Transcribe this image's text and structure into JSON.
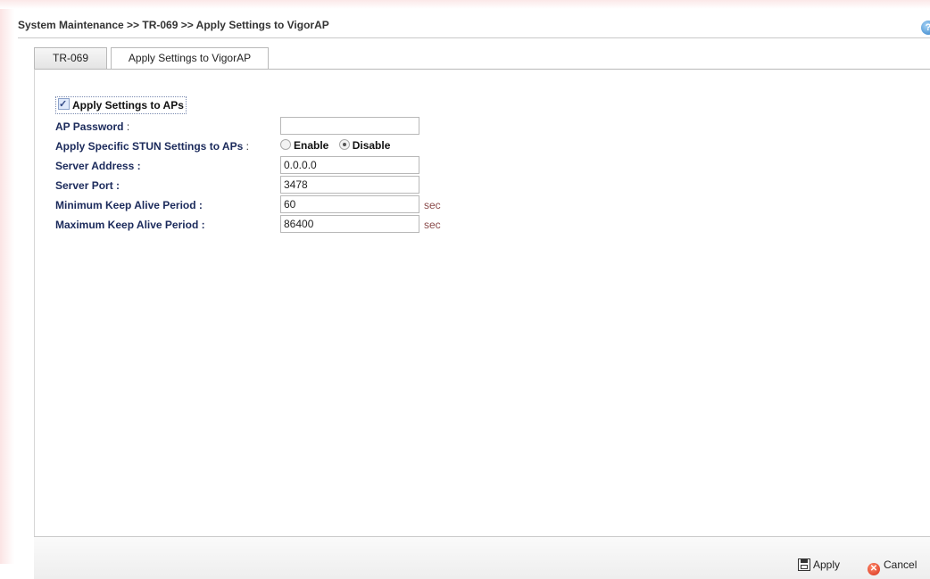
{
  "breadcrumb": "System Maintenance >> TR-069 >> Apply Settings to VigorAP",
  "help_icon": "?",
  "tabs": [
    {
      "label": "TR-069",
      "active": false
    },
    {
      "label": "Apply Settings to VigorAP",
      "active": true
    }
  ],
  "form": {
    "apply_settings": {
      "label": "Apply Settings to APs",
      "checked": true
    },
    "ap_password": {
      "label": "AP Password",
      "suffix": " :",
      "value": ""
    },
    "stun": {
      "label": "Apply Specific STUN Settings to APs",
      "suffix": " :",
      "options": [
        "Enable",
        "Disable"
      ],
      "selected": "Disable"
    },
    "server_address": {
      "label": "Server Address :",
      "value": "0.0.0.0"
    },
    "server_port": {
      "label": "Server Port :",
      "value": "3478"
    },
    "min_keep_alive": {
      "label": "Minimum Keep Alive Period :",
      "value": "60",
      "unit": "sec"
    },
    "max_keep_alive": {
      "label": "Maximum Keep Alive Period :",
      "value": "86400",
      "unit": "sec"
    }
  },
  "footer": {
    "apply_label": "Apply",
    "cancel_label": "Cancel"
  }
}
